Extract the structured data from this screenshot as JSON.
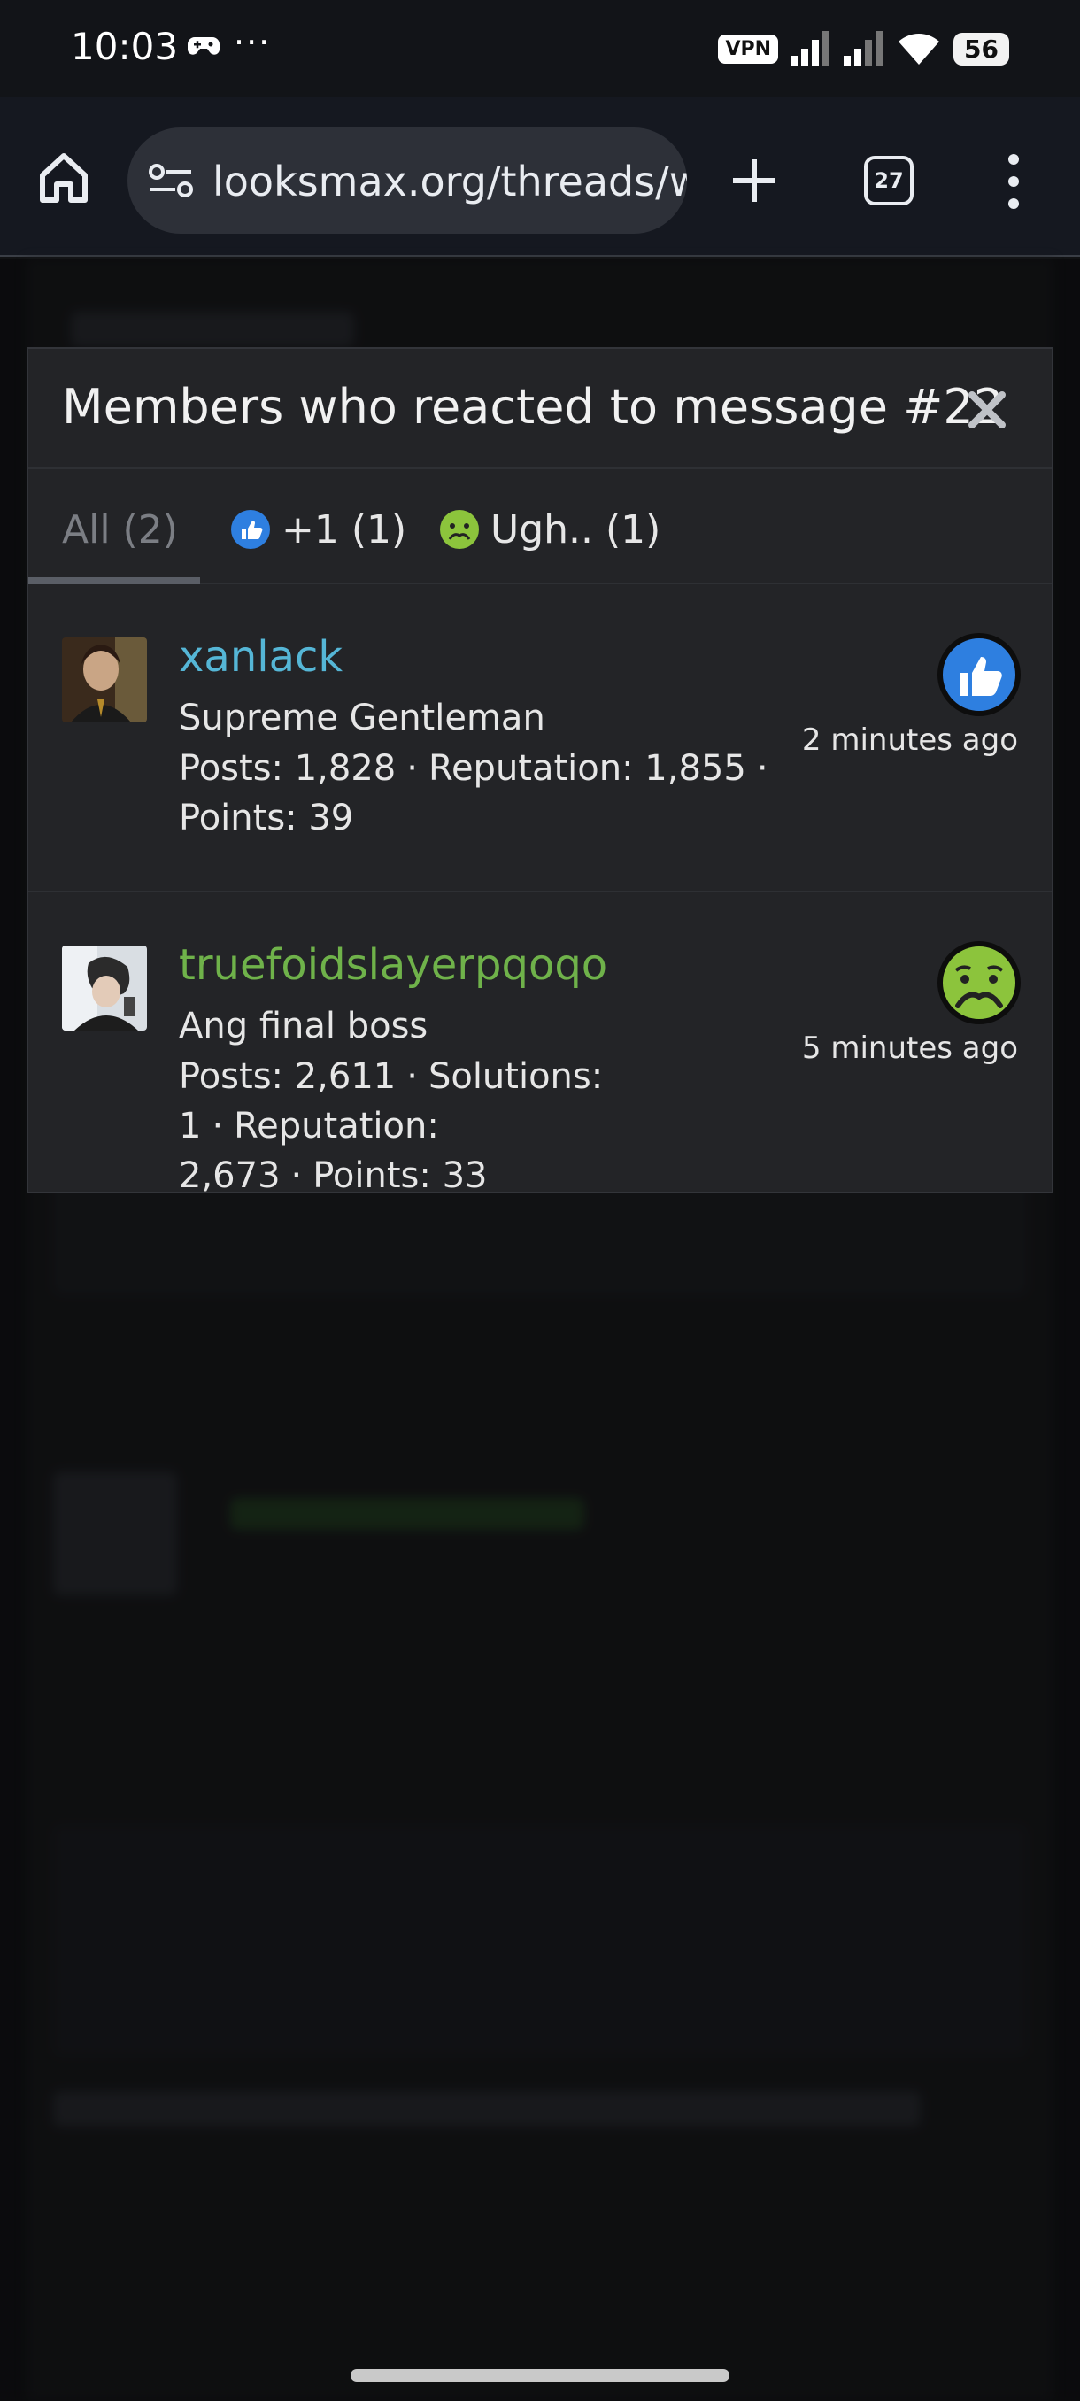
{
  "status_bar": {
    "time": "10:03",
    "dots": "···",
    "vpn": "VPN",
    "battery": "56"
  },
  "browser": {
    "url": "looksmax.org/threads/w",
    "tab_count": "27"
  },
  "modal": {
    "title": "Members who reacted to message #22",
    "tabs": [
      {
        "label": "All (2)"
      },
      {
        "label": "+1 (1)",
        "icon": "thumbs-up-icon"
      },
      {
        "label": "Ugh.. (1)",
        "icon": "sick-face-icon"
      }
    ],
    "members": [
      {
        "name": "xanlack",
        "name_color": "#55b6d6",
        "title": "Supreme Gentleman",
        "stats_line1": "Posts: 1,828",
        "stats_line2": "Reputation: 1,855",
        "stats_line3": "Points: 39",
        "reaction": "thumbs-up-icon",
        "time": "2 minutes ago"
      },
      {
        "name": "truefoidslayerpqoqo",
        "name_color": "#6fb24a",
        "title": "Ang final boss",
        "stats_line1": "Posts: 2,611",
        "stats_line2": "Solutions: 1",
        "stats_line3": "Reputation:",
        "stats_line4": "2,673",
        "stats_line5": "Points: 33",
        "reaction": "sick-face-icon",
        "time": "5 minutes ago"
      }
    ]
  },
  "colors": {
    "accent_blue": "#2e7fe0",
    "sick_green": "#8cc43c"
  }
}
